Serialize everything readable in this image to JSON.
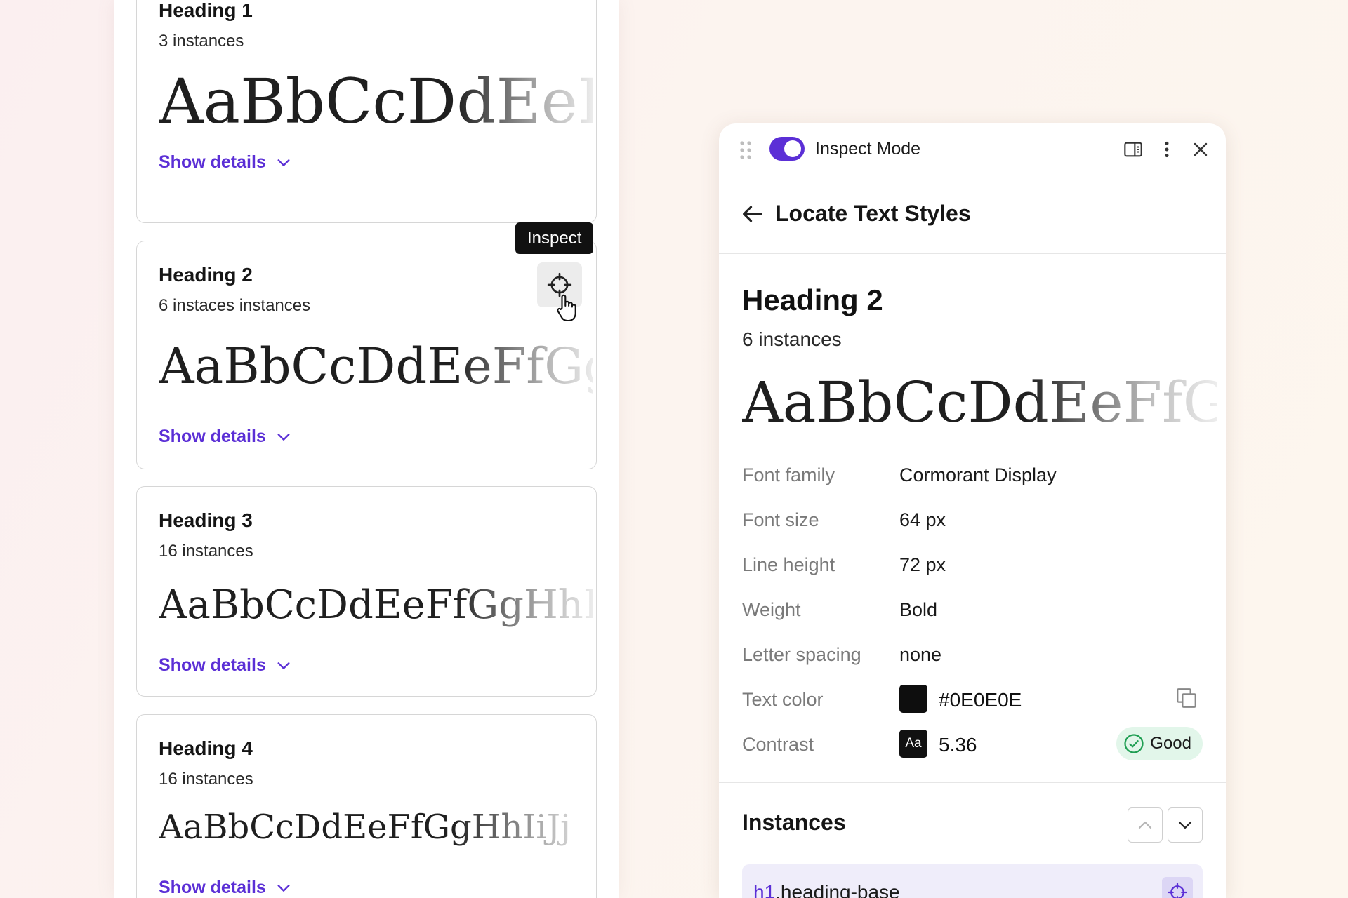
{
  "left_panel": {
    "cards": [
      {
        "title": "Heading 1",
        "count": "3 instances",
        "sample": "AaBbCcDdEeFfGg",
        "details_label": "Show details"
      },
      {
        "title": "Heading 2",
        "count": "6 instaces instances",
        "sample": "AaBbCcDdEeFfGgHh",
        "details_label": "Show details"
      },
      {
        "title": "Heading 3",
        "count": "16 instances",
        "sample": "AaBbCcDdEeFfGgHhIi",
        "details_label": "Show details"
      },
      {
        "title": "Heading 4",
        "count": "16 instances",
        "sample": "AaBbCcDdEeFfGgHhIiJj",
        "details_label": "Show details"
      }
    ],
    "tooltip": "Inspect"
  },
  "inspector": {
    "mode_label": "Inspect Mode",
    "toggle_on": true,
    "page_title": "Locate Text Styles",
    "style_name": "Heading 2",
    "style_count": "6 instances",
    "sample": "AaBbCcDdEeFfGg",
    "properties": {
      "font_family": {
        "label": "Font family",
        "value": "Cormorant Display"
      },
      "font_size": {
        "label": "Font size",
        "value": "64 px"
      },
      "line_height": {
        "label": "Line height",
        "value": "72 px"
      },
      "weight": {
        "label": "Weight",
        "value": "Bold"
      },
      "letter_spacing": {
        "label": "Letter spacing",
        "value": "none"
      },
      "text_color": {
        "label": "Text color",
        "value": "#0E0E0E",
        "swatch": "#0E0E0E"
      },
      "contrast": {
        "label": "Contrast",
        "badge": "Aa",
        "value": "5.36",
        "rating": "Good"
      }
    },
    "instances": {
      "title": "Instances",
      "items": [
        {
          "tag": "h1",
          "selector": ".heading-base"
        }
      ]
    }
  },
  "colors": {
    "accent": "#5b2fd6",
    "good_bg": "#e2f6ea",
    "good_icon": "#1e9e52"
  }
}
